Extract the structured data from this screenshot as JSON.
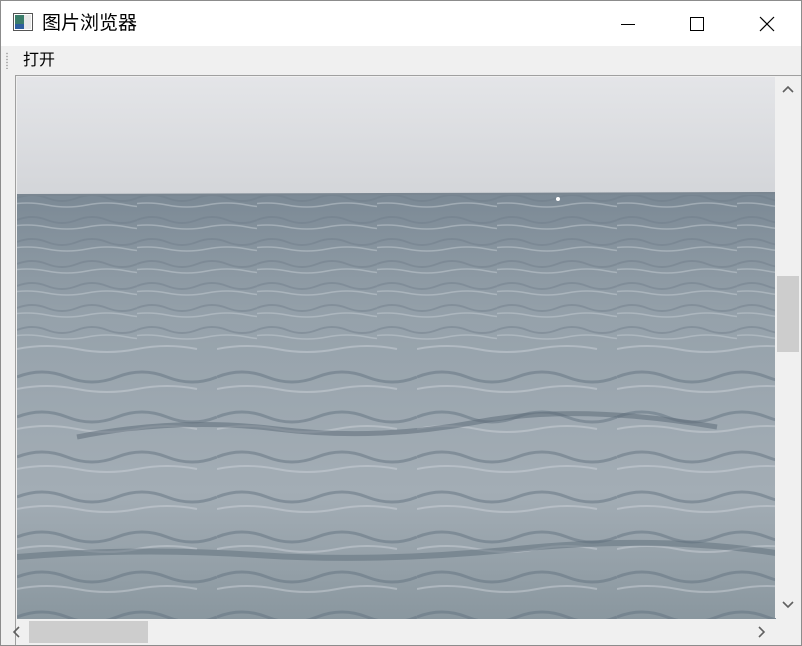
{
  "window": {
    "title": "图片浏览器",
    "app_icon": "image-viewer-app-icon",
    "controls": {
      "minimize_icon": "minimize-icon",
      "maximize_icon": "maximize-icon",
      "close_icon": "close-icon"
    }
  },
  "toolbar": {
    "open_label": "打开"
  },
  "viewer": {
    "image_subject": "sea-horizon-photo",
    "vertical_scroll_position": 0.42,
    "horizontal_scroll_position": 0.0
  },
  "colors": {
    "titlebar_bg": "#ffffff",
    "chrome_bg": "#f0f0f0",
    "scroll_thumb": "#cdcdcd",
    "sky": "#dcdde1",
    "sea": "#8d9aa4"
  }
}
